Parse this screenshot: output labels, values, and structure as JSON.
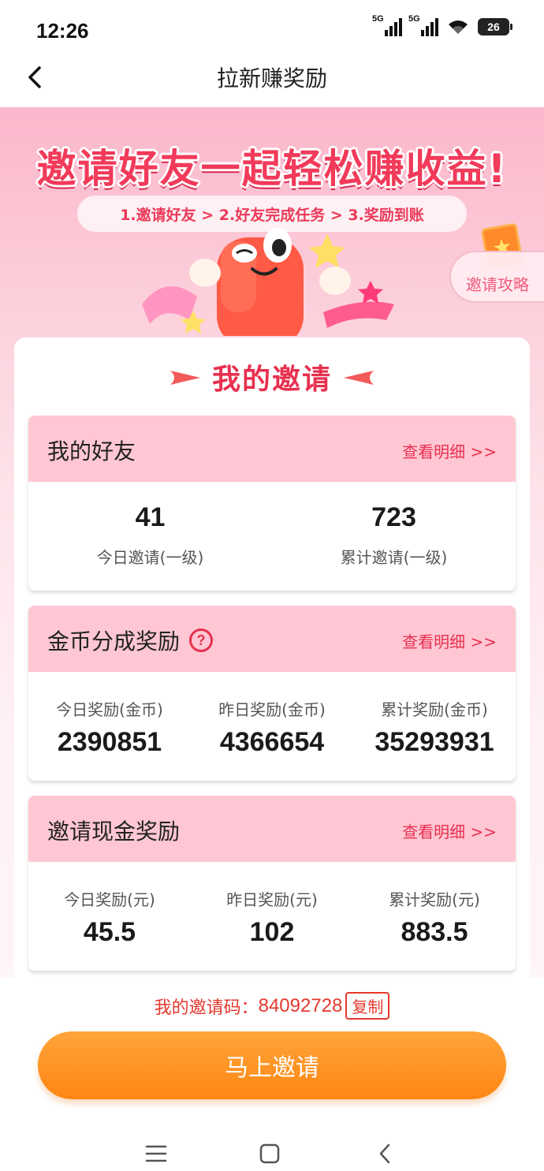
{
  "status_bar": {
    "time": "12:26",
    "signal1_label": "5G",
    "signal2_label": "5G",
    "battery": "26"
  },
  "header": {
    "title": "拉新赚奖励",
    "back_icon": "chevron-left-icon"
  },
  "hero": {
    "title": "邀请好友一起轻松赚收益!",
    "steps": "1.邀请好友 > 2.好友完成任务 > 3.奖励到账",
    "guide_label": "邀请攻略"
  },
  "section": {
    "title": "我的邀请"
  },
  "friends": {
    "title": "我的好友",
    "detail": "查看明细 >>",
    "today_value": "41",
    "today_label": "今日邀请(一级)",
    "total_value": "723",
    "total_label": "累计邀请(一级)"
  },
  "coins": {
    "title": "金币分成奖励",
    "help": "?",
    "detail": "查看明细 >>",
    "today_label": "今日奖励(金币)",
    "today_value": "2390851",
    "yesterday_label": "昨日奖励(金币)",
    "yesterday_value": "4366654",
    "total_label": "累计奖励(金币)",
    "total_value": "35293931"
  },
  "cash": {
    "title": "邀请现金奖励",
    "detail": "查看明细 >>",
    "today_label": "今日奖励(元)",
    "today_value": "45.5",
    "yesterday_label": "昨日奖励(元)",
    "yesterday_value": "102",
    "total_label": "累计奖励(元)",
    "total_value": "883.5"
  },
  "bottom": {
    "code_label": "我的邀请码：",
    "code_value": "84092728",
    "copy_label": "复制",
    "invite_button": "马上邀请"
  },
  "colors": {
    "accent": "#e8304f",
    "header_pink": "#ffc7d3",
    "button_orange": "#ff8613"
  }
}
